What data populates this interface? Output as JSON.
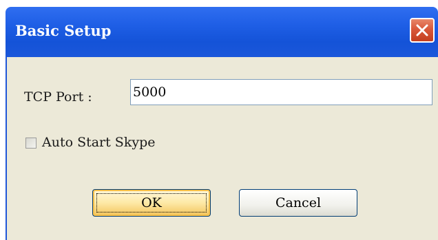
{
  "window": {
    "title": "Basic Setup"
  },
  "form": {
    "tcp_port_label": "TCP Port :",
    "tcp_port_value": "5000",
    "auto_start_label": "Auto Start Skype",
    "auto_start_checked": false
  },
  "buttons": {
    "ok_label": "OK",
    "cancel_label": "Cancel"
  },
  "icons": {
    "close": "close-icon"
  },
  "colors": {
    "titlebar": "#1f5fe6",
    "close_button": "#d9583a",
    "client_background": "#ece9d8",
    "ok_button": "#fde9a6"
  }
}
